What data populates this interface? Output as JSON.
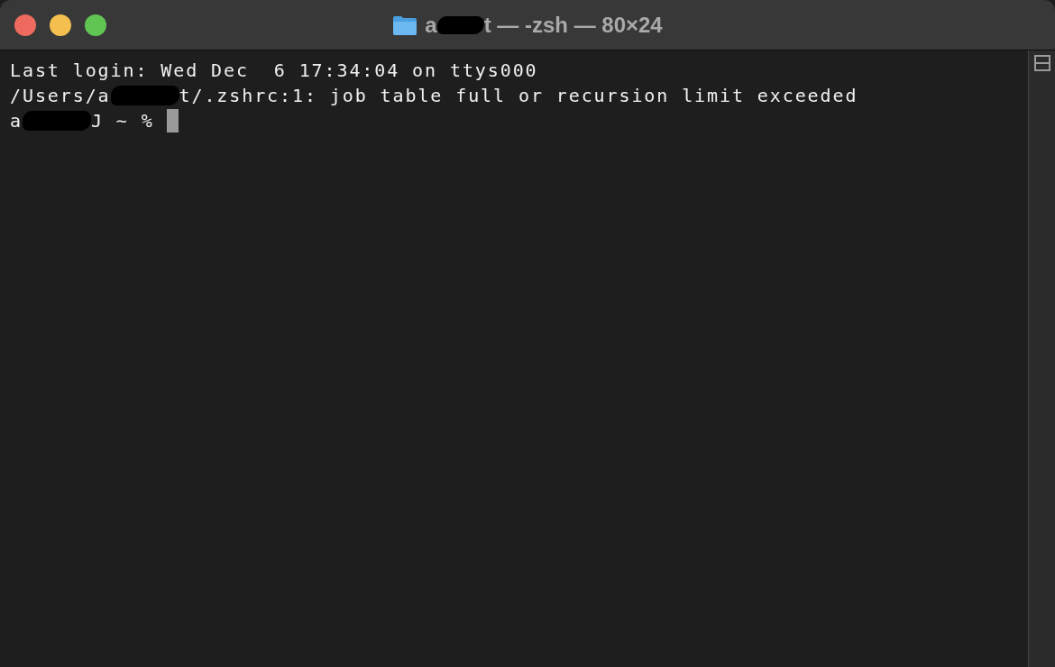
{
  "window": {
    "title": [
      {
        "kind": "text",
        "text": "a"
      },
      {
        "kind": "redacted"
      },
      {
        "kind": "text",
        "text": "t — -zsh — 80×24"
      }
    ]
  },
  "terminal": {
    "lines": [
      [
        {
          "kind": "text",
          "text": "Last login: Wed Dec  6 17:34:04 on ttys000"
        }
      ],
      [
        {
          "kind": "text",
          "text": "/Users/a"
        },
        {
          "kind": "redacted"
        },
        {
          "kind": "text",
          "text": "t/.zshrc:1: job table full or recursion limit exceeded"
        }
      ],
      [
        {
          "kind": "text",
          "text": "a"
        },
        {
          "kind": "redacted"
        },
        {
          "kind": "text",
          "text": "J ~ % "
        },
        {
          "kind": "cursor"
        }
      ]
    ]
  }
}
